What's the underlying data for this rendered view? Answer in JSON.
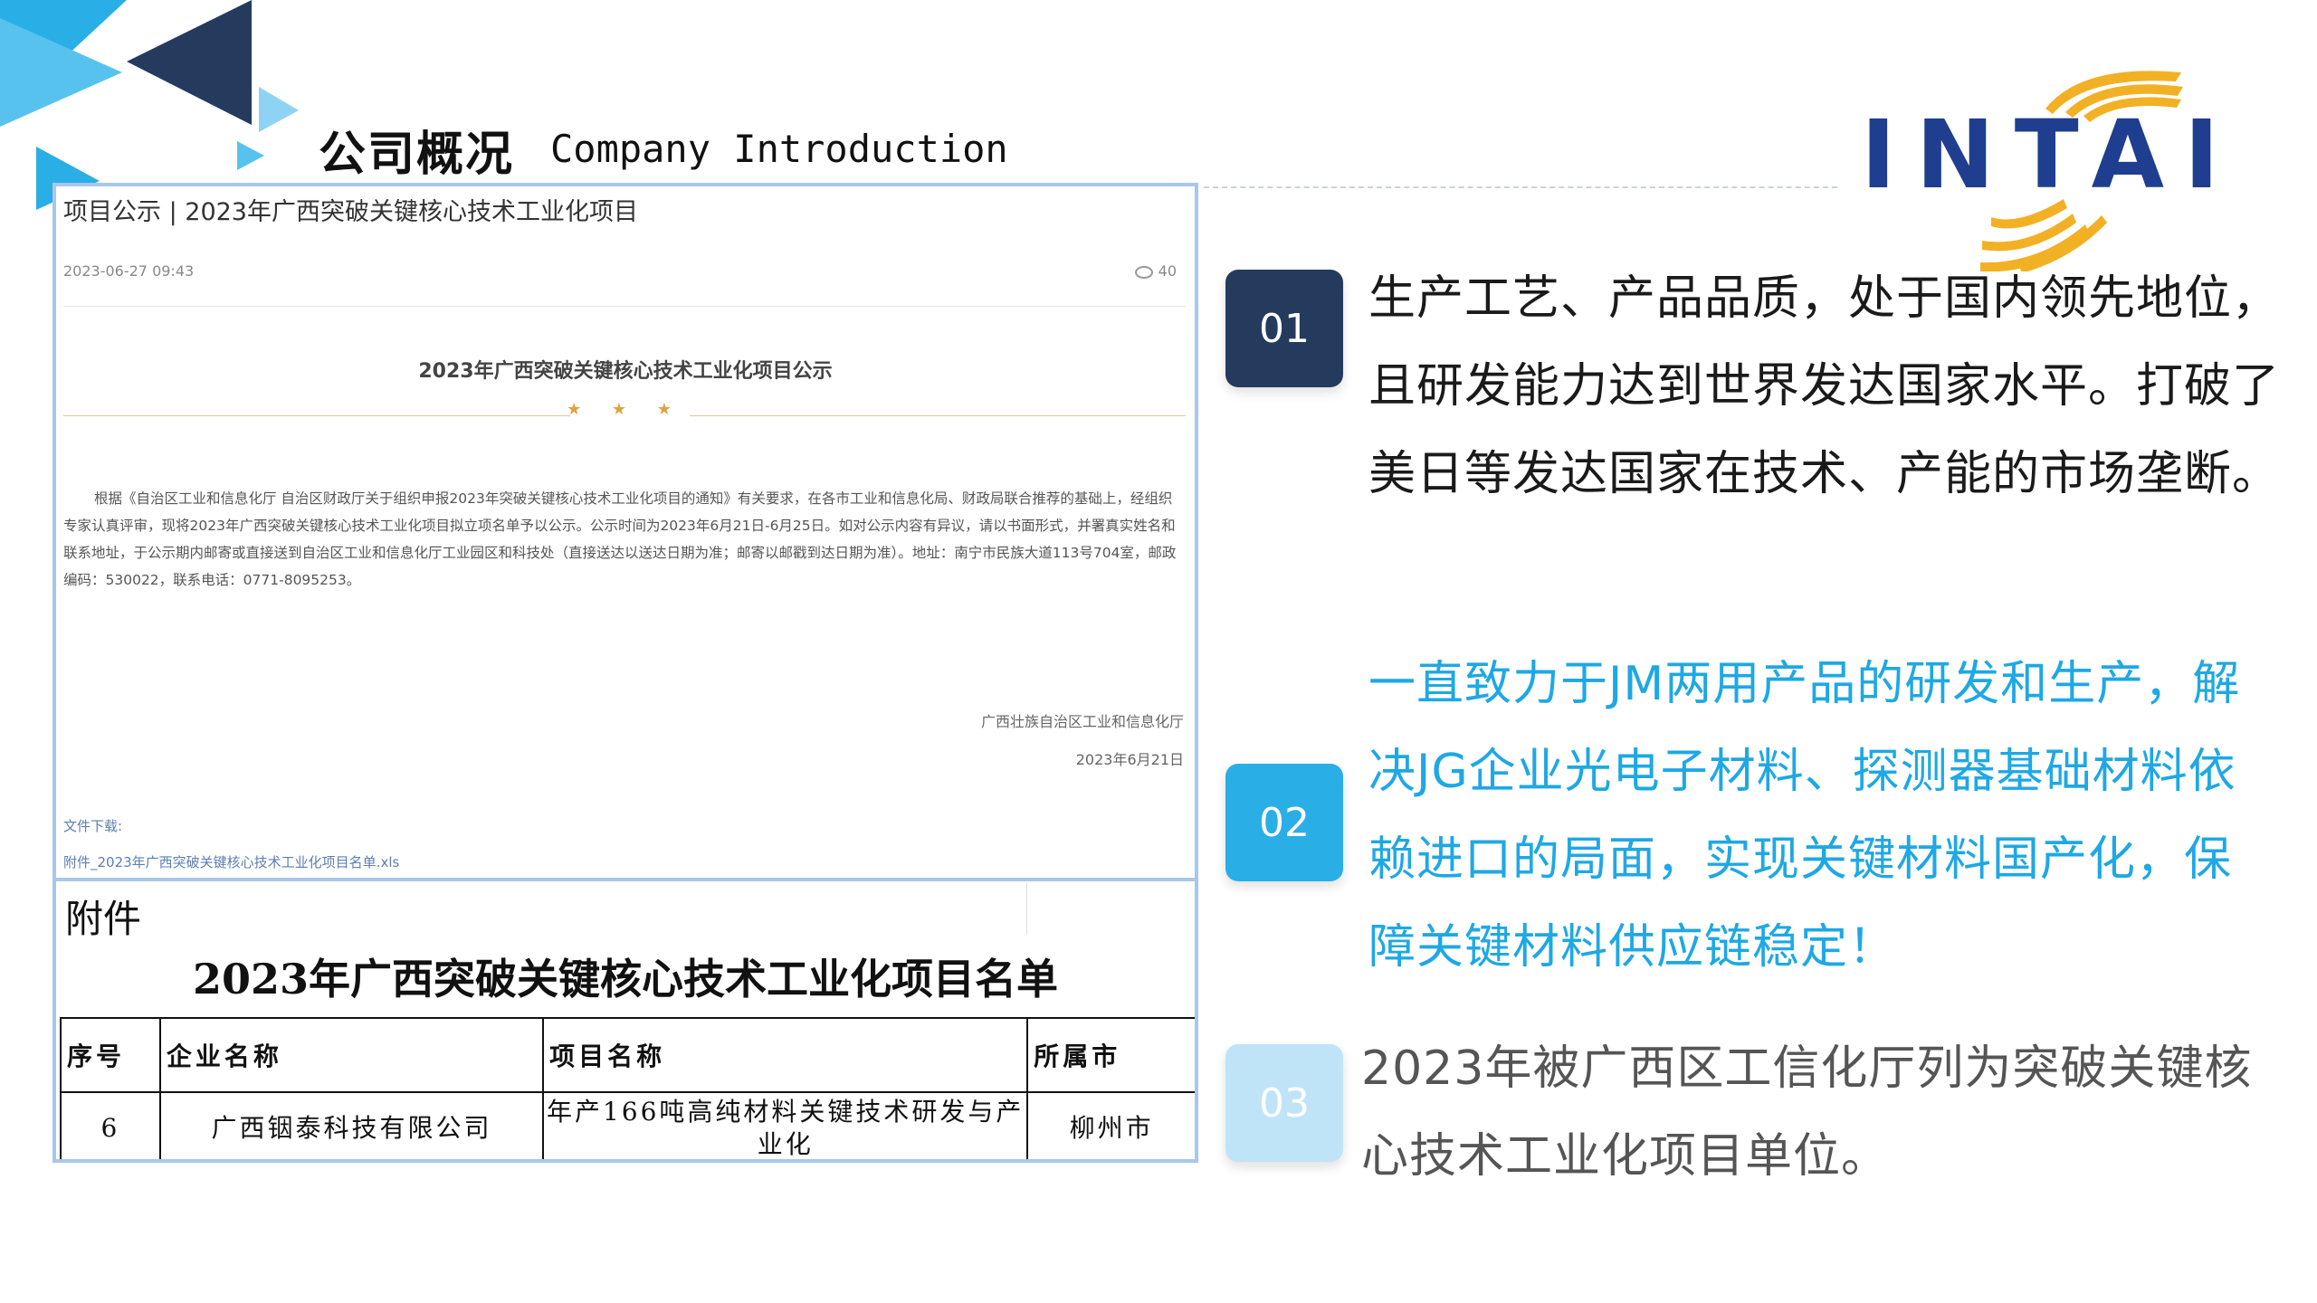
{
  "header": {
    "title_cn": "公司概况",
    "title_en": "Company Introduction"
  },
  "logo": {
    "text": "INTAI",
    "color": "#1f3e8f",
    "accent": "#f2b124"
  },
  "notice": {
    "title": "项目公示 | 2023年广西突破关键核心技术工业化项目",
    "date": "2023-06-27 09:43",
    "views": "40",
    "heading": "2023年广西突破关键核心技术工业化项目公示",
    "stars": "★ ★ ★",
    "body": "根据《自治区工业和信息化厅 自治区财政厅关于组织申报2023年突破关键核心技术工业化项目的通知》有关要求，在各市工业和信息化局、财政局联合推荐的基础上，经组织专家认真评审，现将2023年广西突破关键核心技术工业化项目拟立项名单予以公示。公示时间为2023年6月21日-6月25日。如对公示内容有异议，请以书面形式，并署真实姓名和联系地址，于公示期内邮寄或直接送到自治区工业和信息化厅工业园区和科技处（直接送达以送达日期为准；邮寄以邮戳到达日期为准）。地址：南宁市民族大道113号704室，邮政编码：530022，联系电话：0771-8095253。",
    "sign_org": "广西壮族自治区工业和信息化厅",
    "sign_date": "2023年6月21日",
    "download_label": "文件下载:",
    "download_file": "附件_2023年广西突破关键核心技术工业化项目名单.xls"
  },
  "annex": {
    "label": "附件",
    "list_title": "2023年广西突破关键核心技术工业化项目名单",
    "headers": [
      "序号",
      "企业名称",
      "项目名称",
      "所属市"
    ],
    "row": [
      "6",
      "广西铟泰科技有限公司",
      "年产166吨高纯材料关键技术研发与产业化",
      "柳州市"
    ]
  },
  "items": [
    {
      "num": "01",
      "text": "生产工艺、产品品质，处于国内领先地位，且研发能力达到世界发达国家水平。打破了美日等发达国家在技术、产能的市场垄断。",
      "color": "#243b5e"
    },
    {
      "num": "02",
      "text": "一直致力于JM两用产品的研发和生产，解决JG企业光电子材料、探测器基础材料依赖进口的局面，实现关键材料国产化，保障关键材料供应链稳定！",
      "color": "#2aaee6"
    },
    {
      "num": "03",
      "text": "2023年被广西区工信化厅列为突破关键核心技术工业化项目单位。",
      "color": "#bfe4f8"
    }
  ]
}
